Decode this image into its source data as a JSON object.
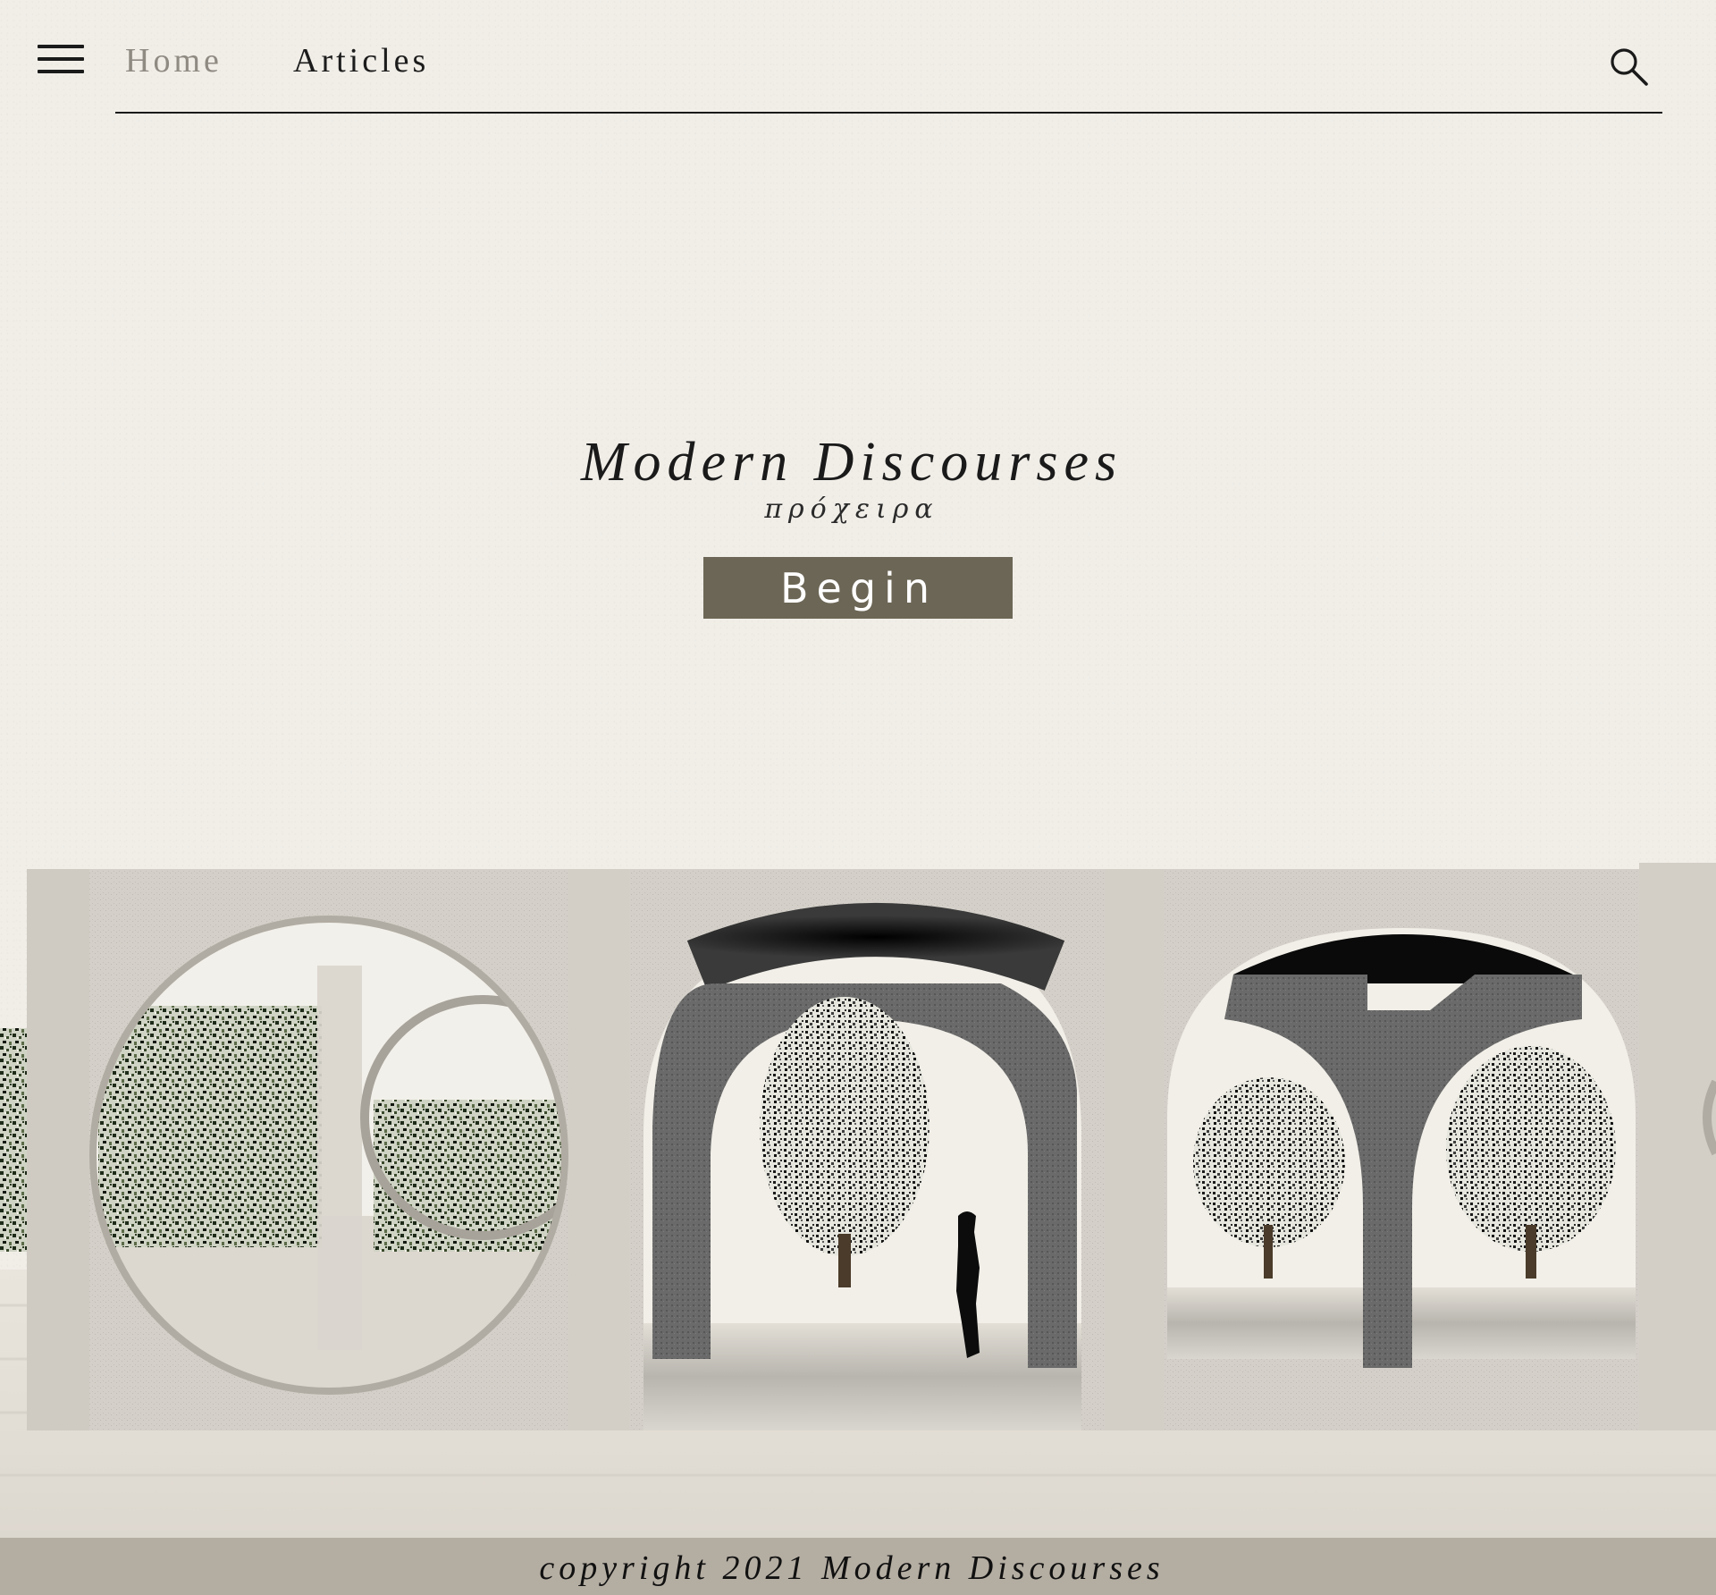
{
  "nav": {
    "menu_icon": "hamburger-menu-icon",
    "links": [
      {
        "label": "Home",
        "active": false
      },
      {
        "label": "Articles",
        "active": true
      }
    ],
    "search_icon": "search-icon"
  },
  "hero": {
    "title": "Modern Discourses",
    "subtitle": "πρόχειρα",
    "cta_label": "Begin"
  },
  "illustration": {
    "subject": "colonnade-with-arches-and-trees"
  },
  "footer": {
    "copyright": "copyright 2021 Modern Discourses"
  },
  "colors": {
    "background": "#f1eee8",
    "button": "#6c6656",
    "footer": "#b4ada2",
    "text": "#1a1a1a",
    "nav_muted": "#8f8a82"
  }
}
